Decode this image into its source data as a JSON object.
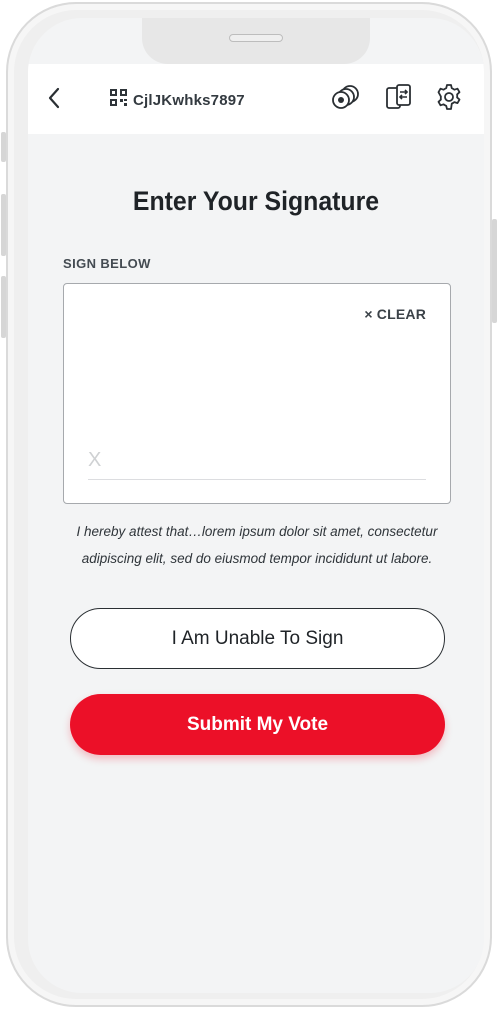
{
  "header": {
    "back_icon": "chevron-left-icon",
    "qr_icon": "qr-code-icon",
    "ballot_code": "CjlJKwhks7897",
    "icons": [
      "view-toggle-icon",
      "device-transfer-icon",
      "gear-icon"
    ]
  },
  "main": {
    "title": "Enter Your Signature",
    "sign_label": "SIGN BELOW",
    "signature_pad": {
      "clear_label": "× CLEAR",
      "x_marker": "X"
    },
    "attestation": "I hereby attest that…lorem ipsum dolor sit amet, consectetur adipiscing elit, sed do eiusmod tempor incididunt ut labore.",
    "unable_button": "I Am Unable To Sign",
    "submit_button": "Submit My Vote"
  },
  "colors": {
    "accent": "#ec1028",
    "background": "#f3f4f5",
    "text": "#1f2327"
  }
}
